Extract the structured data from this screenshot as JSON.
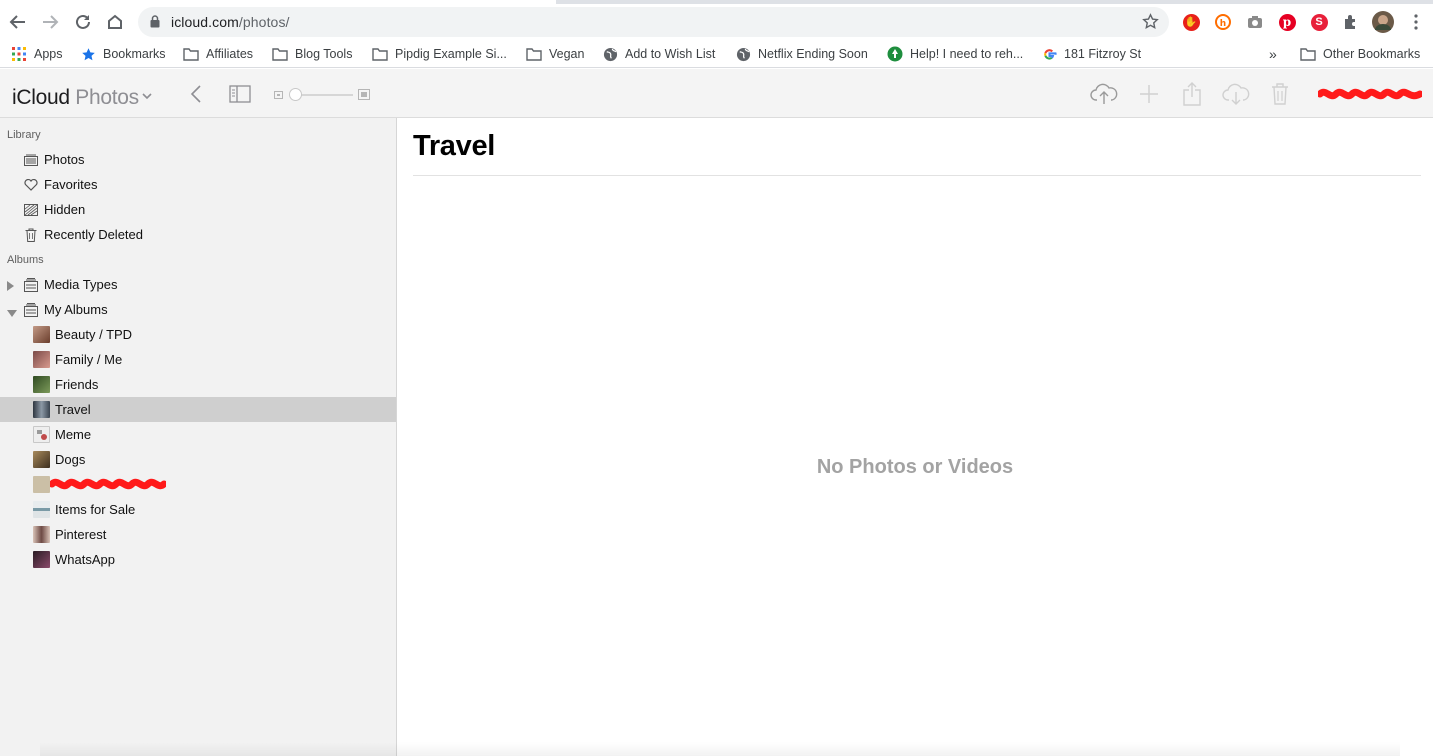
{
  "browser": {
    "url_host": "icloud.com",
    "url_path": "/photos/",
    "nav": [
      "back-icon",
      "forward-icon",
      "reload-icon",
      "home-icon"
    ],
    "extensions": [
      {
        "name": "adblock-icon",
        "color": "#e8201a"
      },
      {
        "name": "honey-icon",
        "color": "#ff6d00"
      },
      {
        "name": "camera-icon",
        "color": "#8a8a8a"
      },
      {
        "name": "pinterest-icon",
        "color": "#e60023"
      },
      {
        "name": "s-extension-icon",
        "color": "#e8203a"
      },
      {
        "name": "puzzle-extensions-icon",
        "color": "#5f6368"
      }
    ]
  },
  "bookmarks": {
    "items": [
      {
        "label": "Apps",
        "icon": "apps-grid-icon"
      },
      {
        "label": "Bookmarks",
        "icon": "star-icon"
      },
      {
        "label": "Affiliates",
        "icon": "folder-icon"
      },
      {
        "label": "Blog Tools",
        "icon": "folder-icon"
      },
      {
        "label": "Pipdig Example Si...",
        "icon": "folder-icon"
      },
      {
        "label": "Vegan",
        "icon": "folder-icon"
      },
      {
        "label": "Add to Wish List",
        "icon": "globe-icon"
      },
      {
        "label": "Netflix Ending Soon",
        "icon": "globe-icon"
      },
      {
        "label": "Help! I need to reh...",
        "icon": "green-badge-icon"
      },
      {
        "label": "181 Fitzroy St",
        "icon": "google-icon"
      }
    ],
    "overflow": "»",
    "other": "Other Bookmarks"
  },
  "header": {
    "title_main": "iCloud",
    "title_sub": "Photos"
  },
  "sidebar": {
    "library_label": "Library",
    "library": [
      {
        "label": "Photos",
        "icon": "photos-icon"
      },
      {
        "label": "Favorites",
        "icon": "heart-icon"
      },
      {
        "label": "Hidden",
        "icon": "hidden-icon"
      },
      {
        "label": "Recently Deleted",
        "icon": "trash-icon"
      }
    ],
    "albums_label": "Albums",
    "groups": [
      {
        "label": "Media Types",
        "expanded": false
      },
      {
        "label": "My Albums",
        "expanded": true
      }
    ],
    "albums": [
      {
        "label": "Beauty / TPD",
        "thumb": "#8a5a44"
      },
      {
        "label": "Family / Me",
        "thumb": "#b0706a"
      },
      {
        "label": "Friends",
        "thumb": "#3e5a2e"
      },
      {
        "label": "Travel",
        "thumb": "#4a5560",
        "selected": true
      },
      {
        "label": "Meme",
        "thumb": "#d8d8d8"
      },
      {
        "label": "Dogs",
        "thumb": "#6e5a3c"
      },
      {
        "label": "",
        "thumb": "#cbbfa6",
        "redacted": true
      },
      {
        "label": "Items for Sale",
        "thumb": "#9aa4a8"
      },
      {
        "label": "Pinterest",
        "thumb": "#a07f78"
      },
      {
        "label": "WhatsApp",
        "thumb": "#5a3a4a"
      }
    ]
  },
  "main": {
    "title": "Travel",
    "empty_message": "No Photos or Videos"
  },
  "colors": {
    "redaction": "#ff1a1a",
    "selected_row": "#cfcfcf",
    "sidebar_bg": "#f2f2f2"
  }
}
